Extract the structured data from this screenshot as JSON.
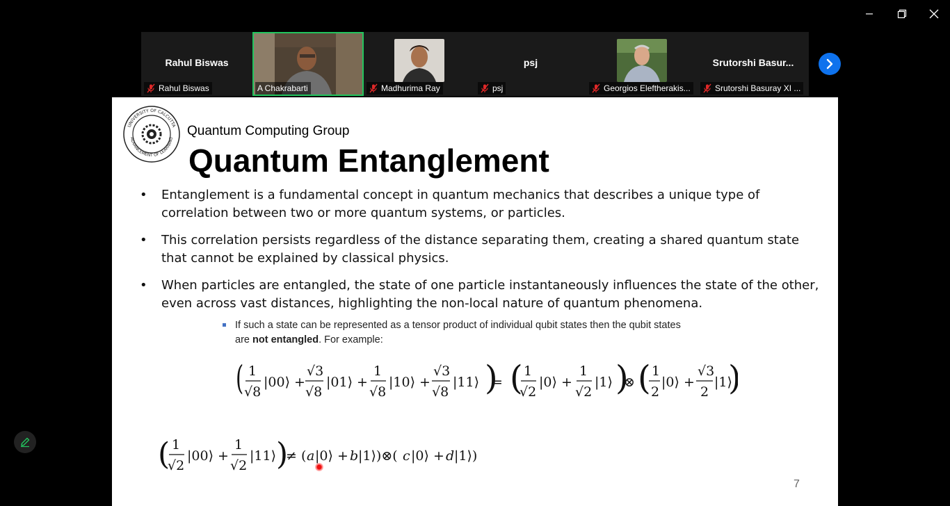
{
  "window": {
    "controls": [
      {
        "name": "minimize",
        "icon": "minimize-icon"
      },
      {
        "name": "restore",
        "icon": "restore-icon"
      },
      {
        "name": "close",
        "icon": "close-icon"
      }
    ]
  },
  "participants": [
    {
      "center_name": "Rahul Biswas",
      "label": "Rahul Biswas",
      "muted": true,
      "video": false
    },
    {
      "center_name": "",
      "label": "A Chakrabarti",
      "muted": false,
      "video": true,
      "active_speaker": true
    },
    {
      "center_name": "",
      "label": "Madhurima Ray",
      "muted": true,
      "video": false,
      "avatar": true
    },
    {
      "center_name": "psj",
      "label": "psj",
      "muted": true,
      "video": false
    },
    {
      "center_name": "",
      "label": "Georgios Eleftherakis...",
      "muted": true,
      "video": false,
      "avatar": true
    },
    {
      "center_name": "Srutorshi  Basur...",
      "label": "Srutorshi Basuray XI ...",
      "muted": true,
      "video": false
    }
  ],
  "strip_next_icon": "chevron-right-icon",
  "slide": {
    "group_title": "Quantum Computing Group",
    "title": "Quantum Entanglement",
    "bullets": [
      "Entanglement is a fundamental concept in quantum mechanics that describes a unique type of correlation between two or more quantum systems, or particles.",
      "This correlation persists regardless of the distance separating them, creating a shared quantum state that cannot be explained by classical physics.",
      "When particles are entangled, the state of one particle instantaneously influences the state of the other, even across vast distances, highlighting the non-local nature of quantum phenomena."
    ],
    "sub_bullet_pre": "If such a state can be represented as a tensor product of individual qubit states then the qubit states are ",
    "sub_bullet_bold": "not entangled",
    "sub_bullet_post": ". For example:",
    "equation_1": "(1/√8|00⟩ + √3/√8|01⟩ + 1/√8|10⟩ + √3/√8|11⟩) = (1/√2|0⟩ + 1/√2|1⟩) ⊗ (1/2|0⟩ + √3/2|1⟩)",
    "equation_2": "(1/√2|00⟩ + 1/√2|11⟩) ≠ (a|0⟩ + b|1⟩)⊗(c|0⟩ + d|1⟩)",
    "page_number": "7",
    "logo_text": "UNIVERSITY OF CALCUTTA · ADVANCEMENT OF LEARNING"
  },
  "annotate_icon": "pencil-icon",
  "colors": {
    "active_speaker": "#22c55e",
    "next_button": "#0e72ed",
    "muted_icon": "#e02828"
  }
}
